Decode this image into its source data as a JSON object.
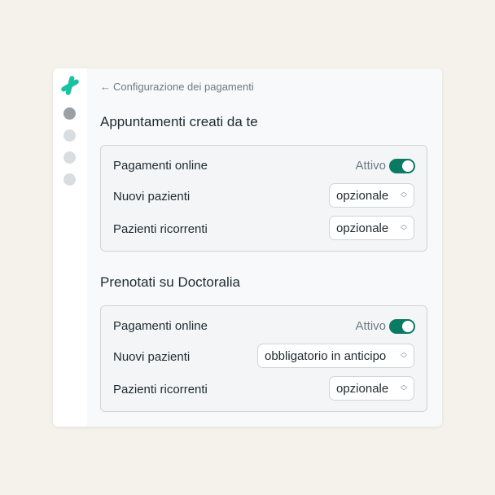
{
  "header": {
    "back_label": "Configurazione dei pagamenti"
  },
  "sections": [
    {
      "title": "Appuntamenti creati da te",
      "payments_label": "Pagamenti online",
      "status": "Attivo",
      "rows": [
        {
          "label": "Nuovi pazienti",
          "value": "opzionale"
        },
        {
          "label": "Pazienti ricorrenti",
          "value": "opzionale"
        }
      ]
    },
    {
      "title": "Prenotati su Doctoralia",
      "payments_label": "Pagamenti online",
      "status": "Attivo",
      "rows": [
        {
          "label": "Nuovi pazienti",
          "value": "obbligatorio in anticipo"
        },
        {
          "label": "Pazienti ricorrenti",
          "value": "opzionale"
        }
      ]
    }
  ],
  "colors": {
    "accent": "#0a7a64",
    "logo": "#19c2a0",
    "background": "#f5f1eb"
  },
  "icons": [
    "doctoralia-logo-icon",
    "back-arrow-icon",
    "chevron-updown-icon"
  ]
}
